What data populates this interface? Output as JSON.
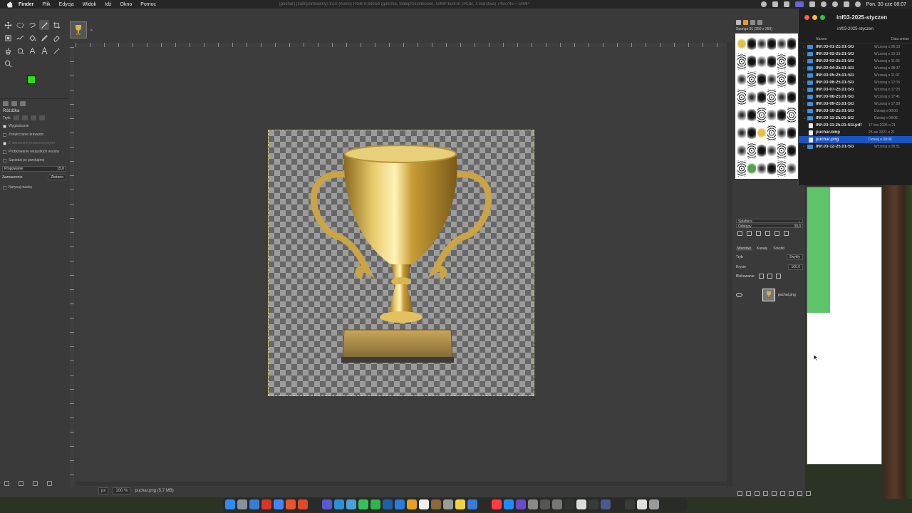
{
  "menubar": {
    "app_name": "Finder",
    "menus": [
      "Plik",
      "Edycja",
      "Widok",
      "Idź",
      "Okno",
      "Pomoc"
    ],
    "window_title": "[puchar] (zaimportowany)-13.0 (Kolory RGB 8-bitowe (gamma, stałoprzecinkowe), GIMP built-in sRGB, 1 warstwa) 745x745 – GIMP",
    "clock": "Pon. 30 cze 08:07"
  },
  "colors": {
    "foreground": "#27e019",
    "background": "#ffffff",
    "selection": "#1a55c6",
    "folder": "#3d8fd8"
  },
  "toolbox": {
    "panel_title": "Różdżka",
    "mode_label": "Tryb:",
    "options": [
      {
        "label": "Wygładzanie",
        "checked": true,
        "enabled": true
      },
      {
        "label": "Zmiękczanie krawędzi",
        "checked": false,
        "enabled": true
      },
      {
        "label": "Z obszarami przezroczystymi",
        "checked": true,
        "enabled": false
      },
      {
        "label": "Próbkowanie wszystkich warstw",
        "checked": false,
        "enabled": true
      },
      {
        "label": "Sąsiedzi po przekątnej",
        "checked": false,
        "enabled": true
      }
    ],
    "threshold_label": "Progowanie",
    "threshold_value": "15,0",
    "select_by_label": "Zaznaczenie",
    "select_by_value": "Złożone",
    "draw_mask_label": "Narysuj maskę"
  },
  "statusbar": {
    "unit": "px",
    "zoom": "100 %",
    "file_info": "puchar.png (5,7 MB)"
  },
  "brushes": {
    "title": "Sponge 01 (250 x 250)",
    "category": "Splatters",
    "spacing_label": "Odstępy",
    "spacing_value": "30,0"
  },
  "layers": {
    "tabs": [
      "Warstwy",
      "Kanały",
      "Ścieżki"
    ],
    "mode_label": "Tryb",
    "mode_value": "Zwykły",
    "opacity_label": "Krycie",
    "opacity_value": "100,0",
    "lock_label": "Blokowanie:",
    "layer_name": "puchar.png"
  },
  "finder": {
    "title": "inf03-2025-styczen",
    "path": "inf03-2025-styczen",
    "col_name": "Nazwa",
    "col_date": "Data zmian",
    "rows": [
      {
        "name": "INF.03-01-25.01-SG",
        "date": "Wczoraj o 09:13",
        "kind": "folder",
        "level": 0,
        "selected": false
      },
      {
        "name": "INF.03-02-25.01-SG",
        "date": "Wczoraj o 10:13",
        "kind": "folder",
        "level": 0,
        "selected": false
      },
      {
        "name": "INF.03-03-25.01-SG",
        "date": "Wczoraj o 11:25",
        "kind": "folder",
        "level": 0,
        "selected": false
      },
      {
        "name": "INF.03-04-25.01-SG",
        "date": "Wczoraj o 08:37",
        "kind": "folder",
        "level": 0,
        "selected": false
      },
      {
        "name": "INF.03-05-25.01-SG",
        "date": "Wczoraj o 11:47",
        "kind": "folder",
        "level": 0,
        "selected": false
      },
      {
        "name": "INF.03-06-25.01-SG",
        "date": "Wczoraj o 12:15",
        "kind": "folder",
        "level": 0,
        "selected": false
      },
      {
        "name": "INF.03-07-25.01-SG",
        "date": "Wczoraj o 17:25",
        "kind": "folder",
        "level": 0,
        "selected": false
      },
      {
        "name": "INF.03-08-25.01-SG",
        "date": "Wczoraj o 17:41",
        "kind": "folder",
        "level": 0,
        "selected": false
      },
      {
        "name": "INF.03-09-25.01-SG",
        "date": "Wczoraj o 17:59",
        "kind": "folder",
        "level": 0,
        "selected": false
      },
      {
        "name": "INF.03-10-25.01-SG",
        "date": "Dzisiaj o 08:00",
        "kind": "folder",
        "level": 0,
        "selected": false
      },
      {
        "name": "INF.03-11-25.01-SG",
        "date": "Dzisiaj o 08:06",
        "kind": "folder",
        "level": 0,
        "selected": false,
        "expanded": true
      },
      {
        "name": "INF.03-11-25.01-SG.pdf",
        "date": "17 kwi 2025 o 21",
        "kind": "file",
        "level": 1,
        "selected": false
      },
      {
        "name": "puchar.bmp",
        "date": "25 sie 2021 o 21",
        "kind": "file",
        "level": 1,
        "selected": false
      },
      {
        "name": "puchar.png",
        "date": "Dzisiaj o 08:06",
        "kind": "file",
        "level": 1,
        "selected": true
      },
      {
        "name": "INF.03-12-25.01-SG",
        "date": "Wczoraj o 08:51",
        "kind": "folder",
        "level": 0,
        "selected": false
      }
    ]
  }
}
